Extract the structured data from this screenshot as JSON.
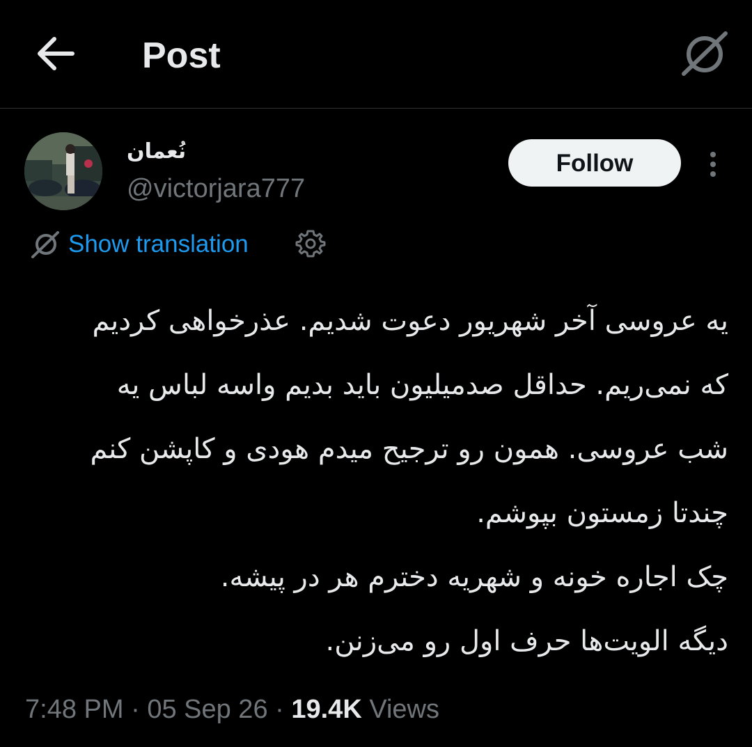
{
  "header": {
    "title": "Post",
    "back_icon": "arrow-left-icon",
    "translate_icon": "translate-icon"
  },
  "author": {
    "display_name": "نُعمان",
    "handle": "@victorjara777",
    "follow_label": "Follow"
  },
  "translation": {
    "show_label": "Show translation"
  },
  "tweet": {
    "lines": [
      "یه عروسی آخر شهریور دعوت شدیم. عذرخواهی کردیم",
      "که نمی‌ریم. حداقل صدمیلیون باید بدیم واسه لباس یه",
      "شب عروسی. همون رو ترجیح میدم هودی و کاپشن کنم",
      "چندتا زمستون بپوشم.",
      "چک اجاره خونه و شهریه دخترم هر در پیشه.",
      "دیگه الویت‌ها حرف اول رو می‌زنن."
    ]
  },
  "meta": {
    "time": "7:48 PM",
    "separator": " · ",
    "date": "05 Sep 26",
    "views_count": "19.4K",
    "views_label": " Views"
  },
  "colors": {
    "background": "#000000",
    "text": "#e7e9ea",
    "muted": "#71767b",
    "link": "#1d9bf0",
    "follow_bg": "#eff3f4",
    "divider": "#2f3336"
  }
}
